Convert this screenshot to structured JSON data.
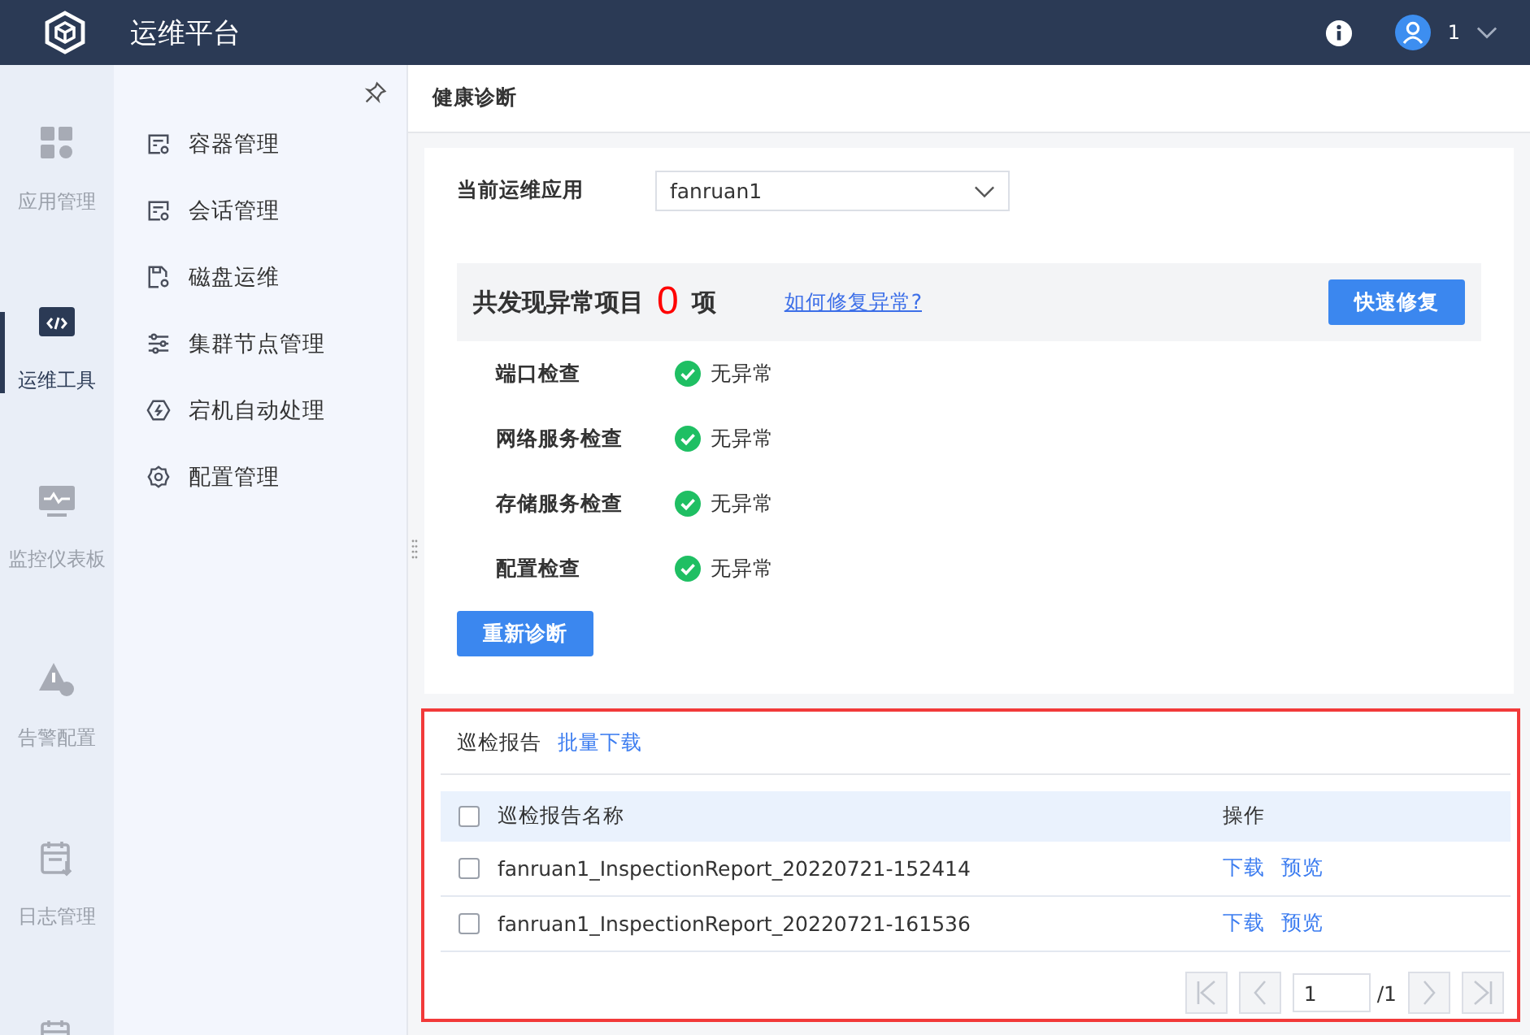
{
  "app_title": "运维平台",
  "header": {
    "user": "1"
  },
  "rail": [
    {
      "label": "应用管理",
      "kind": "apps",
      "selected": false
    },
    {
      "label": "运维工具",
      "kind": "code",
      "selected": true
    },
    {
      "label": "监控仪表板",
      "kind": "monitor",
      "selected": false
    },
    {
      "label": "告警配置",
      "kind": "alert",
      "selected": false
    },
    {
      "label": "日志管理",
      "kind": "calendar",
      "selected": false
    }
  ],
  "submenu": [
    {
      "label": "容器管理",
      "kind": "doc"
    },
    {
      "label": "会话管理",
      "kind": "doc"
    },
    {
      "label": "磁盘运维",
      "kind": "disk"
    },
    {
      "label": "集群节点管理",
      "kind": "sliders"
    },
    {
      "label": "宕机自动处理",
      "kind": "bolt"
    },
    {
      "label": "配置管理",
      "kind": "gear"
    }
  ],
  "page_title": "健康诊断",
  "app_select": {
    "label": "当前运维应用",
    "value": "fanruan1"
  },
  "summary": {
    "prefix": "共发现异常项目",
    "count": "0",
    "suffix": "项",
    "help_link": "如何修复异常?",
    "fix_button": "快速修复"
  },
  "checks": [
    {
      "name": "端口检查",
      "ok": true,
      "result": "无异常"
    },
    {
      "name": "网络服务检查",
      "ok": true,
      "result": "无异常"
    },
    {
      "name": "存储服务检查",
      "ok": true,
      "result": "无异常"
    },
    {
      "name": "配置检查",
      "ok": true,
      "result": "无异常"
    }
  ],
  "rediagnose_button": "重新诊断",
  "reports": {
    "title": "巡检报告",
    "batch_link": "批量下载",
    "columns": [
      "巡检报告名称",
      "操作"
    ],
    "header_checked": false,
    "rows": [
      {
        "name": "fanruan1_InspectionReport_20220721-152414",
        "checked": false,
        "actions": [
          "下载",
          "预览"
        ]
      },
      {
        "name": "fanruan1_InspectionReport_20220721-161536",
        "checked": false,
        "actions": [
          "下载",
          "预览"
        ]
      }
    ],
    "pagination": {
      "page": "1",
      "total": "/1",
      "prev_disabled": true,
      "next_disabled": true
    }
  }
}
